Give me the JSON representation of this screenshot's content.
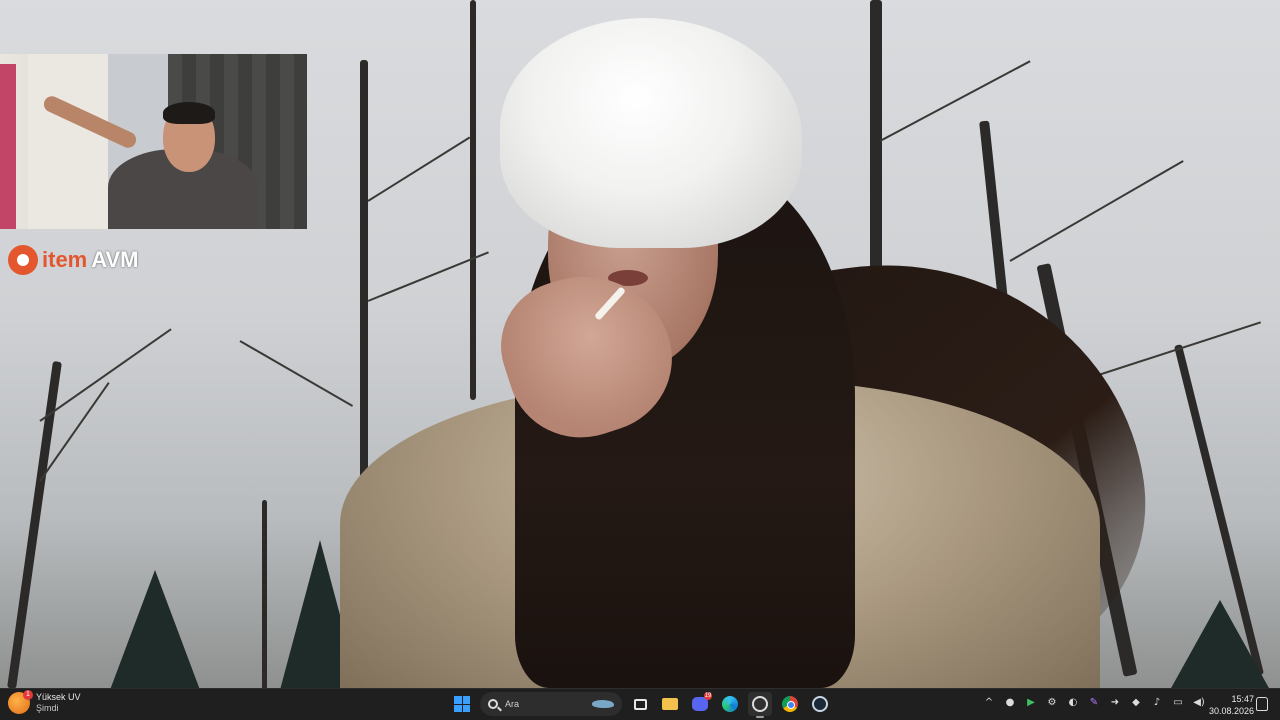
{
  "brand_overlay": {
    "prefix": "item",
    "suffix": "AVM"
  },
  "taskbar": {
    "widget": {
      "title": "Yüksek UV",
      "subtitle": "Şimdi",
      "badge": "1"
    },
    "search": {
      "placeholder": "Ara"
    },
    "apps": [
      {
        "name": "start",
        "icon": "windows-logo-icon"
      },
      {
        "name": "task-view",
        "icon": "task-view-icon"
      },
      {
        "name": "file-explorer",
        "icon": "folder-icon"
      },
      {
        "name": "discord",
        "icon": "discord-icon",
        "badge": "19"
      },
      {
        "name": "edge",
        "icon": "edge-icon"
      },
      {
        "name": "obs",
        "icon": "obs-icon",
        "active": true
      },
      {
        "name": "chrome",
        "icon": "chrome-icon"
      },
      {
        "name": "steam",
        "icon": "steam-icon"
      }
    ],
    "tray_icons": [
      "chevron-up-icon",
      "game-controller-icon",
      "play-icon",
      "settings-icon",
      "steam-tray-icon",
      "pen-icon",
      "arrow-icon",
      "shield-icon",
      "microphone-icon",
      "network-icon",
      "volume-icon"
    ],
    "clock": {
      "time": "15:47",
      "date": "30.08.2026"
    }
  },
  "colors": {
    "taskbar_bg": "#1f1f1f",
    "brand_orange": "#e4572e",
    "win_blue": "#3aa0ff"
  }
}
